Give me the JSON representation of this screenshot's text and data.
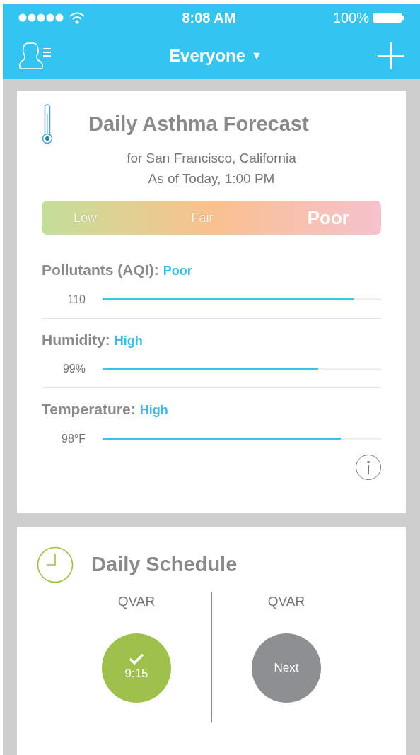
{
  "status_bar": {
    "time": "8:08 AM",
    "battery": "100%"
  },
  "nav": {
    "title": "Everyone",
    "caret": "▼"
  },
  "forecast": {
    "title": "Daily Asthma Forecast",
    "location": "for San Francisco, California",
    "as_of": "As of Today, 1:00 PM",
    "scale": [
      {
        "label": "Low",
        "selected": false
      },
      {
        "label": "Fair",
        "selected": false
      },
      {
        "label": "Poor",
        "selected": true
      }
    ],
    "metrics": [
      {
        "label": "Pollutants (AQI):",
        "rating": "Poor",
        "reading": "110",
        "level": 0.9
      },
      {
        "label": "Humidity:",
        "rating": "High",
        "reading": "99%",
        "level": 0.775
      },
      {
        "label": "Temperature:",
        "rating": "High",
        "reading": "98°F",
        "level": 0.855
      }
    ]
  },
  "schedule": {
    "title": "Daily Schedule",
    "doses": [
      {
        "name": "QVAR",
        "kind": "taken",
        "text": "9:15"
      },
      {
        "name": "QVAR",
        "kind": "next",
        "text": "Next"
      }
    ]
  }
}
